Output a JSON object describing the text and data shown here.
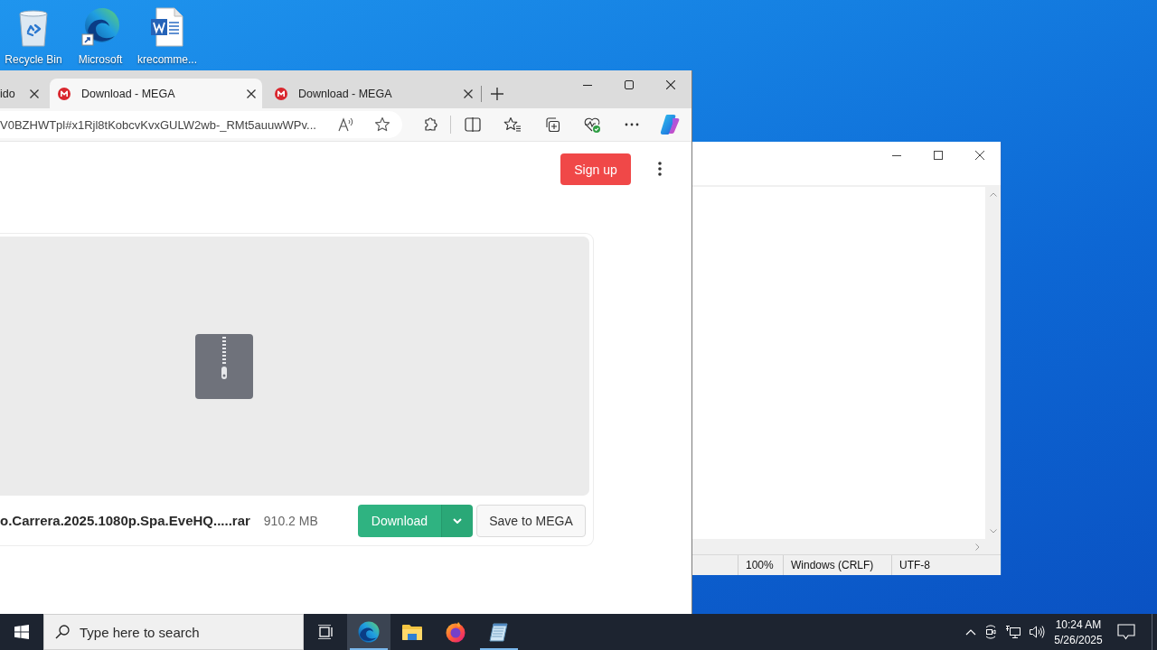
{
  "desktop_icons": [
    {
      "label": "Recycle Bin",
      "kind": "recycle-bin"
    },
    {
      "label": "Microsoft",
      "kind": "edge"
    },
    {
      "label": "krecomme...",
      "kind": "word"
    }
  ],
  "browser": {
    "tabs": [
      {
        "title": "ido",
        "favicon": false,
        "selected": false
      },
      {
        "title": "Download - MEGA",
        "favicon": true,
        "selected": true
      },
      {
        "title": "Download - MEGA",
        "favicon": true,
        "selected": false
      }
    ],
    "address": "V0BZHWTpl#x1Rjl8tKobcvKvxGULW2wb-_RMt5auuwWPv...",
    "page": {
      "sign_up": "Sign up",
      "file": {
        "name": "o.Carrera.2025.1080p.Spa.EveHQ.....rar",
        "size": "910.2 MB"
      },
      "download_button": "Download",
      "save_button": "Save to MEGA"
    }
  },
  "notepad": {
    "status_bar": [
      "100%",
      "Windows (CRLF)",
      "UTF-8"
    ]
  },
  "taskbar": {
    "search_placeholder": "Type here to search",
    "apps": [
      {
        "kind": "edge",
        "active": true,
        "running": true
      },
      {
        "kind": "explorer",
        "active": false,
        "running": false
      },
      {
        "kind": "firefox",
        "active": false,
        "running": false
      },
      {
        "kind": "notepad",
        "active": false,
        "running": true
      }
    ],
    "time": "10:24 AM",
    "date": "5/26/2025"
  }
}
